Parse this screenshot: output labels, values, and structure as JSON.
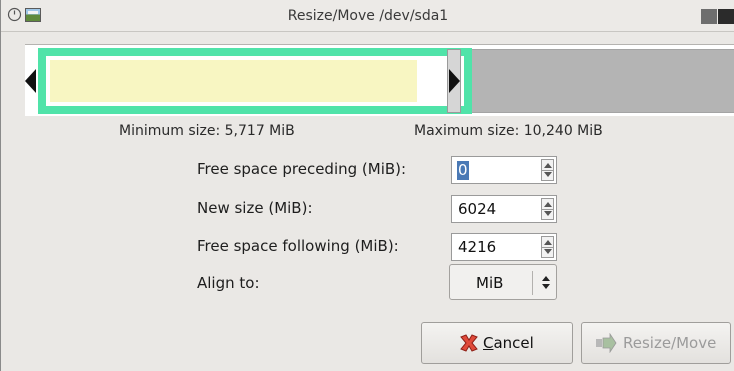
{
  "window": {
    "title": "Resize/Move /dev/sda1"
  },
  "partition_bar": {
    "accent_color": "#50e3a9",
    "used_color": "#f8f6c2",
    "unallocated_color": "#b4b4b4"
  },
  "sizes": {
    "minimum": "Minimum size: 5,717 MiB",
    "maximum": "Maximum size: 10,240 MiB"
  },
  "fields": {
    "free_preceding": {
      "label": "Free space preceding (MiB):",
      "value": "0"
    },
    "new_size": {
      "label": "New size (MiB):",
      "value": "6024"
    },
    "free_following": {
      "label": "Free space following (MiB):",
      "value": "4216"
    },
    "align": {
      "label": "Align to:",
      "value": "MiB"
    }
  },
  "buttons": {
    "cancel": {
      "label": "Cancel",
      "icon": "cancel-icon"
    },
    "resize": {
      "label": "Resize/Move",
      "icon": "resize-move-icon",
      "enabled": false
    }
  }
}
